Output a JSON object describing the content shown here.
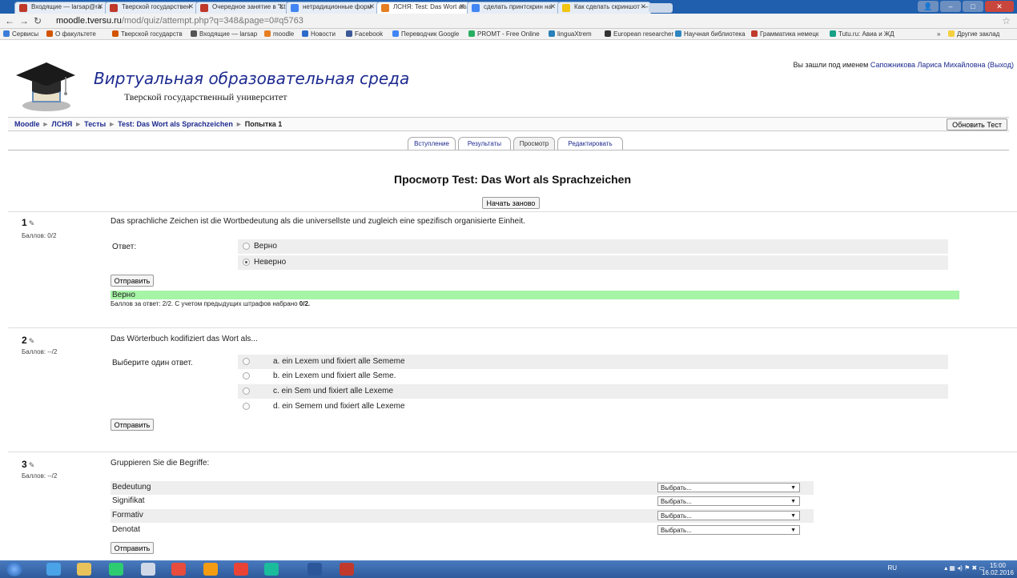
{
  "browser": {
    "tabs": [
      {
        "label": "Входящие — larsap@ra"
      },
      {
        "label": "Тверской государствен"
      },
      {
        "label": "Очередное занятие в \"Lt"
      },
      {
        "label": "нетрадиционные форм"
      },
      {
        "label": "ЛСНЯ: Test: Das Wort als"
      },
      {
        "label": "сделать принтскрин на"
      },
      {
        "label": "Как сделать скриншот —"
      }
    ],
    "url_host": "moodle.tversu.ru",
    "url_path": "/mod/quiz/attempt.php?q=348&page=0#q5763",
    "bookmarks": [
      "Сервисы",
      "О факультете",
      "Тверской государств",
      "Входящие — larsap",
      "moodle",
      "Новости",
      "Facebook",
      "Переводчик Google",
      "PROMT - Free Online",
      "linguaXtrem",
      "European researcher",
      "Научная библиотека",
      "Грамматика немецк",
      "Tutu.ru: Авиа и ЖД",
      "»",
      "Другие заклад"
    ]
  },
  "header": {
    "site_title": "Виртуальная образовательная среда",
    "site_subtitle": "Тверской государственный университет",
    "login_prefix": "Вы зашли под именем",
    "user_name": "Сапожникова Лариса Михайловна",
    "logout": "(Выход)"
  },
  "breadcrumb": {
    "items": [
      "Moodle",
      "ЛСНЯ",
      "Тесты",
      "Test: Das Wort als Sprachzeichen"
    ],
    "current": "Попытка 1",
    "update_button": "Обновить Тест"
  },
  "tabs": [
    "Вступление",
    "Результаты",
    "Просмотр",
    "Редактировать"
  ],
  "page": {
    "heading": "Просмотр Test: Das Wort als Sprachzeichen",
    "restart_button": "Начать заново"
  },
  "questions": [
    {
      "number": "1",
      "grade": "Баллов: 0/2",
      "text": "Das sprachliche Zeichen ist die Wortbedeutung als die universellste und zugleich eine spezifisch organisierte Einheit.",
      "answer_label": "Ответ:",
      "options": [
        "Верно",
        "Неверно"
      ],
      "submit": "Отправить",
      "feedback": "Верно",
      "feedback_note": "Баллов за ответ: 2/2. С учетом предыдущих штрафов набрано",
      "feedback_score": "0/2."
    },
    {
      "number": "2",
      "grade": "Баллов: --/2",
      "text": "Das Wörterbuch kodifiziert das Wort als...",
      "answer_label": "Выберите один ответ.",
      "options": [
        "a. ein Lexem und fixiert alle Sememe",
        "b. ein Lexem und fixiert alle Seme.",
        "c. ein Sem und fixiert alle Lexeme",
        "d. ein Semem und fixiert alle Lexeme"
      ],
      "submit": "Отправить"
    },
    {
      "number": "3",
      "grade": "Баллов: --/2",
      "text": "Gruppieren Sie die Begriffe:",
      "terms": [
        "Bedeutung",
        "Signifikat",
        "Formativ",
        "Denotat"
      ],
      "select_placeholder": "Выбрать...",
      "submit": "Отправить"
    }
  ],
  "taskbar": {
    "lang": "RU",
    "time": "15:00",
    "date": "16.02.2016"
  }
}
